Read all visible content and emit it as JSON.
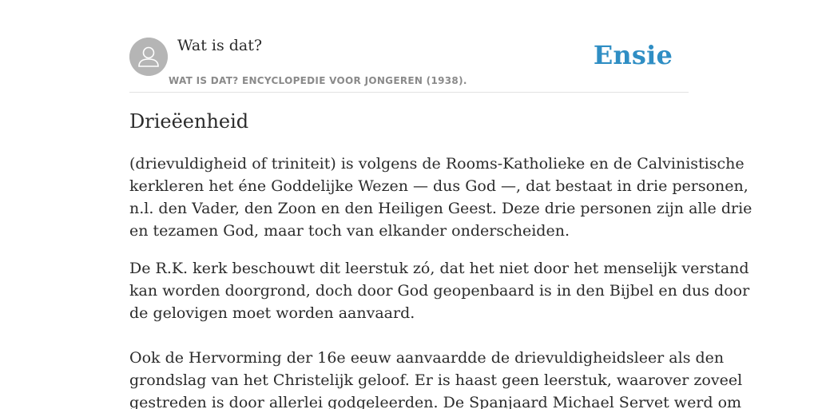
{
  "header": {
    "avatar_icon": "user-silhouette-icon",
    "source_title": "Wat is dat?",
    "source_subtitle": "WAT IS DAT? ENCYCLOPEDIE VOOR JONGEREN (1938).",
    "brand": "Ensie"
  },
  "article": {
    "title": "Drieëenheid",
    "paragraphs": [
      {
        "lines": [
          "(drievuldigheid of triniteit) is volgens de Rooms-Katholieke en de Calvinistische",
          "kerkleren het éne Goddelijke Wezen — dus God —, dat bestaat in drie personen,",
          "n.l. den Vader, den Zoon en den Heiligen Geest. Deze drie personen zijn alle drie",
          "en tezamen God, maar toch van elkander onderscheiden."
        ]
      },
      {
        "lines": [
          "De R.K. kerk beschouwt dit leerstuk zó, dat het niet door het menselijk verstand",
          "kan worden doorgrond, doch door God geopenbaard is in den Bijbel en dus door",
          "de gelovigen moet worden aanvaard."
        ]
      },
      {
        "lines": [
          "Ook de Hervorming der 16e eeuw aanvaardde de drievuldigheidsleer als den",
          "grondslag van het Christelijk geloof. Er is haast geen leerstuk, waarover zoveel",
          "gestreden is door allerlei godgeleerden. De Spanjaard Michael Servet werd om"
        ]
      }
    ]
  }
}
